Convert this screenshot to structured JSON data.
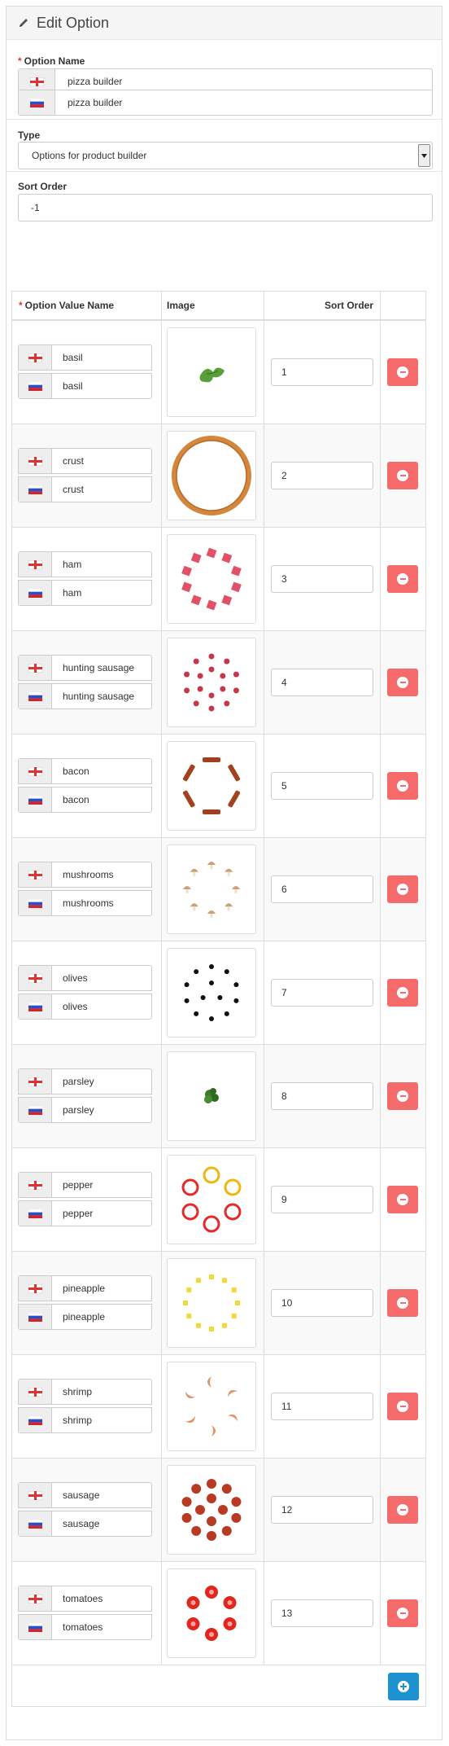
{
  "panel": {
    "title": "Edit Option"
  },
  "option_name": {
    "label": "Option Name",
    "values": [
      {
        "flag": "uk-flag-icon",
        "value": "pizza builder"
      },
      {
        "flag": "ru-flag-icon",
        "value": "pizza builder"
      }
    ]
  },
  "type": {
    "label": "Type",
    "selected": "Options for product builder"
  },
  "sort_order": {
    "label": "Sort Order",
    "value": "-1"
  },
  "table": {
    "headers": {
      "name": "Option Value Name",
      "image": "Image",
      "sort": "Sort Order"
    },
    "rows": [
      {
        "name_en": "basil",
        "name_ru": "basil",
        "sort": "1",
        "image": "basil"
      },
      {
        "name_en": "crust",
        "name_ru": "crust",
        "sort": "2",
        "image": "crust"
      },
      {
        "name_en": "ham",
        "name_ru": "ham",
        "sort": "3",
        "image": "ham"
      },
      {
        "name_en": "hunting sausage",
        "name_ru": "hunting sausage",
        "sort": "4",
        "image": "hunting-sausage"
      },
      {
        "name_en": "bacon",
        "name_ru": "bacon",
        "sort": "5",
        "image": "bacon"
      },
      {
        "name_en": "mushrooms",
        "name_ru": "mushrooms",
        "sort": "6",
        "image": "mushrooms"
      },
      {
        "name_en": "olives",
        "name_ru": "olives",
        "sort": "7",
        "image": "olives"
      },
      {
        "name_en": "parsley",
        "name_ru": "parsley",
        "sort": "8",
        "image": "parsley"
      },
      {
        "name_en": "pepper",
        "name_ru": "pepper",
        "sort": "9",
        "image": "pepper"
      },
      {
        "name_en": "pineapple",
        "name_ru": "pineapple",
        "sort": "10",
        "image": "pineapple"
      },
      {
        "name_en": "shrimp",
        "name_ru": "shrimp",
        "sort": "11",
        "image": "shrimp"
      },
      {
        "name_en": "sausage",
        "name_ru": "sausage",
        "sort": "12",
        "image": "sausage"
      },
      {
        "name_en": "tomatoes",
        "name_ru": "tomatoes",
        "sort": "13",
        "image": "tomatoes"
      }
    ]
  },
  "icons": {
    "heading": "pencil-icon",
    "remove": "minus-circle-icon",
    "add": "plus-circle-icon"
  },
  "colors": {
    "danger": "#f56b6b",
    "primary": "#1e91cf",
    "required": "#e3342f"
  }
}
